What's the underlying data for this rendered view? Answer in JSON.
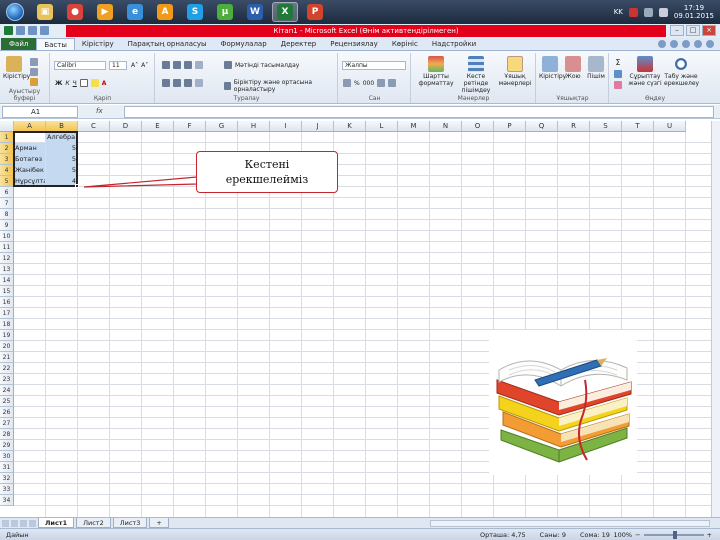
{
  "taskbar": {
    "apps": [
      {
        "name": "windows-explorer",
        "color": "#e8c35a",
        "glyph": "▣"
      },
      {
        "name": "chrome",
        "color": "#d9433a",
        "glyph": "●"
      },
      {
        "name": "media-player",
        "color": "#f0a020",
        "glyph": "▶"
      },
      {
        "name": "internet-explorer",
        "color": "#3b8fd8",
        "glyph": "e"
      },
      {
        "name": "avast",
        "color": "#f09a18",
        "glyph": "A"
      },
      {
        "name": "skype",
        "color": "#1fa0e6",
        "glyph": "S"
      },
      {
        "name": "utorrent",
        "color": "#4cae3c",
        "glyph": "µ"
      },
      {
        "name": "word",
        "color": "#2b5fae",
        "glyph": "W"
      },
      {
        "name": "excel",
        "color": "#1f7a3a",
        "glyph": "X"
      },
      {
        "name": "powerpoint",
        "color": "#d0452b",
        "glyph": "P"
      }
    ],
    "lang": "KK",
    "time": "17:19",
    "date": "09.01.2015"
  },
  "window": {
    "title": "Кітап1 - Microsoft Excel (Өнім активтендірілмеген)"
  },
  "tabs": [
    "Басты",
    "Кірістіру",
    "Парақтың орналасуы",
    "Формулалар",
    "Деректер",
    "Рецензиялау",
    "Көрініс",
    "Надстройки"
  ],
  "file_tab": "Файл",
  "active_tab": "Басты",
  "ribbon": {
    "paste_label": "Кірістіру",
    "clipboard_label": "Ауыстыру буфері",
    "font_name": "Calibri",
    "font_size": "11",
    "font_label": "Қаріп",
    "wrap_text": "Мәтінді тасымалдау",
    "merge_center": "Біріктіру және ортасына орналастыру",
    "alignment_label": "Туралау",
    "number_format": "Жалпы",
    "number_label": "Сан",
    "cond_format": "Шартты форматтау",
    "format_table": "Кесте ретінде пішімдеу",
    "cell_styles": "Ұяшық мәнерлері",
    "styles_label": "Мәнерлер",
    "insert_btn": "Кірістіру",
    "delete_btn": "Жою",
    "format_btn": "Пішім",
    "cells_label": "Ұяшықтар",
    "sort_filter": "Сұрыптау және сүзгі",
    "find_select": "Табу және ерекшелеу",
    "editing_label": "Өңдеу"
  },
  "formula_bar": {
    "name_box": "A1",
    "fx": "fx",
    "value": ""
  },
  "columns": [
    "A",
    "B",
    "C",
    "D",
    "E",
    "F",
    "G",
    "H",
    "I",
    "J",
    "K",
    "L",
    "M",
    "N",
    "O",
    "P",
    "Q",
    "R",
    "S",
    "T",
    "U"
  ],
  "rows": [
    "1",
    "2",
    "3",
    "4",
    "5",
    "6",
    "7",
    "8",
    "9",
    "10",
    "11",
    "12",
    "13",
    "14",
    "15",
    "16",
    "17",
    "18",
    "19",
    "20",
    "21",
    "22",
    "23",
    "24",
    "25",
    "26",
    "27",
    "28",
    "29",
    "30",
    "31",
    "32",
    "33",
    "34"
  ],
  "cells": [
    {
      "col": "B",
      "row": "1",
      "value": "Алгебра",
      "num": false
    },
    {
      "col": "A",
      "row": "2",
      "value": "Арман",
      "num": false
    },
    {
      "col": "B",
      "row": "2",
      "value": "5",
      "num": true
    },
    {
      "col": "A",
      "row": "3",
      "value": "Ботагөз",
      "num": false
    },
    {
      "col": "B",
      "row": "3",
      "value": "5",
      "num": true
    },
    {
      "col": "A",
      "row": "4",
      "value": "Жанібек",
      "num": false
    },
    {
      "col": "B",
      "row": "4",
      "value": "5",
      "num": true
    },
    {
      "col": "A",
      "row": "5",
      "value": "Нұрсұлтан",
      "num": false
    },
    {
      "col": "B",
      "row": "5",
      "value": "4",
      "num": true
    }
  ],
  "callout": {
    "line1": "Кестені",
    "line2": "ерекшелейміз"
  },
  "sheets": [
    "Лист1",
    "Лист2",
    "Лист3"
  ],
  "active_sheet": "Лист1",
  "status": {
    "mode": "Дайын",
    "average": "Орташа: 4,75",
    "count": "Саны: 9",
    "sum": "Сома: 19",
    "zoom": "100%"
  },
  "colors": {
    "title_accent": "#e3001b",
    "file_tab": "#2a6e36",
    "selection": "#c5d9f1",
    "callout_border": "#c4262e"
  }
}
